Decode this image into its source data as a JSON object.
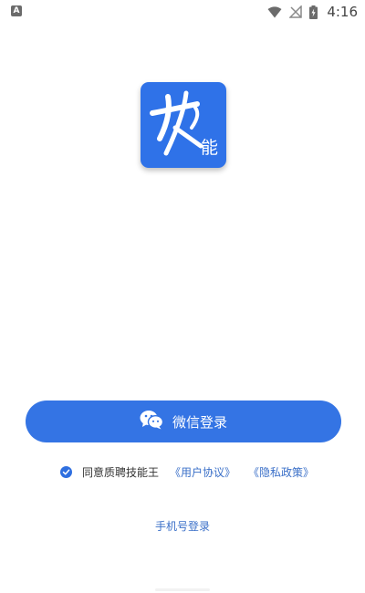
{
  "status_bar": {
    "left_icon": "A",
    "time": "4:16",
    "icons": [
      "wifi-icon",
      "no-signal-icon",
      "battery-charging-icon"
    ]
  },
  "logo": {
    "text": "能",
    "background_color": "#2f72e8"
  },
  "wechat_login": {
    "label": "微信登录",
    "icon": "wechat-icon",
    "color": "#3474e4"
  },
  "agreement": {
    "checked": true,
    "text": "同意质聘技能王",
    "user_agreement_link": "《用户协议》",
    "privacy_policy_link": "《隐私政策》",
    "link_color": "#3a6fc8"
  },
  "phone_login": {
    "label": "手机号登录"
  }
}
